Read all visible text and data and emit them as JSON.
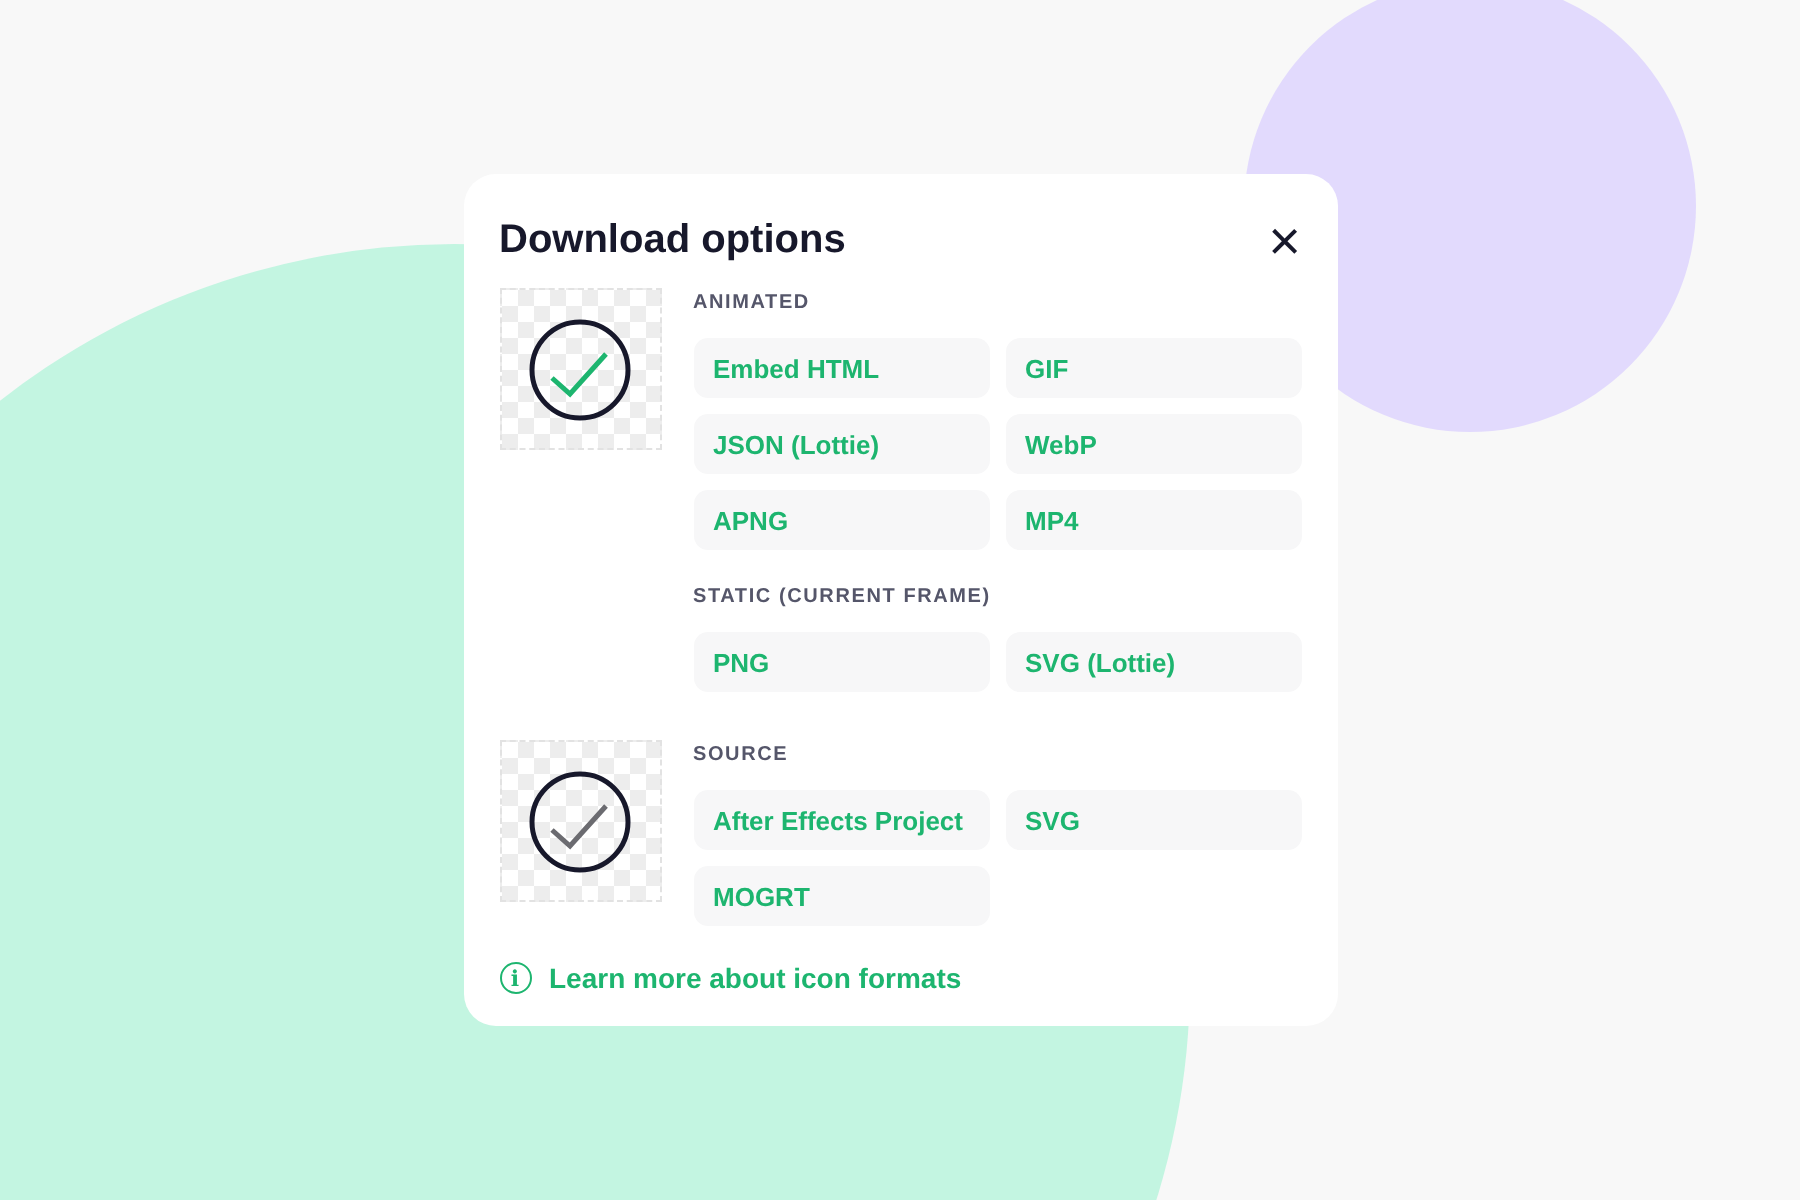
{
  "dialog": {
    "title": "Download options",
    "close": "×"
  },
  "groups": [
    {
      "kind": "color",
      "sections": [
        {
          "heading": "ANIMATED",
          "formats": [
            "Embed HTML",
            "GIF",
            "JSON (Lottie)",
            "WebP",
            "APNG",
            "MP4"
          ]
        },
        {
          "heading": "STATIC (CURRENT FRAME)",
          "formats": [
            "PNG",
            "SVG (Lottie)"
          ]
        }
      ]
    },
    {
      "kind": "mono",
      "sections": [
        {
          "heading": "SOURCE",
          "formats": [
            "After Effects Project",
            "SVG",
            "MOGRT"
          ]
        }
      ]
    }
  ],
  "link": {
    "icon": "i",
    "text": "Learn more about icon formats"
  }
}
